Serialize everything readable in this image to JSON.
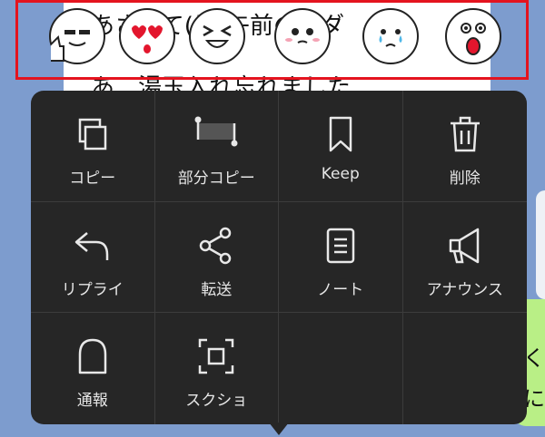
{
  "chat": {
    "line1": "あさって(日)午前の請ダ",
    "line2": "あ　湯玉入れ忘れました",
    "side_line1": "く",
    "side_line2": "に"
  },
  "reactions": [
    {
      "name": "thumbs-up-smile-icon"
    },
    {
      "name": "heart-eyes-icon"
    },
    {
      "name": "laughing-icon"
    },
    {
      "name": "pleading-icon"
    },
    {
      "name": "crying-icon"
    },
    {
      "name": "shocked-icon"
    }
  ],
  "menu": {
    "items": [
      {
        "label": "コピー",
        "icon": "copy-icon"
      },
      {
        "label": "部分コピー",
        "icon": "partial-copy-icon"
      },
      {
        "label": "Keep",
        "icon": "bookmark-icon"
      },
      {
        "label": "削除",
        "icon": "trash-icon"
      },
      {
        "label": "リプライ",
        "icon": "reply-icon"
      },
      {
        "label": "転送",
        "icon": "share-icon"
      },
      {
        "label": "ノート",
        "icon": "note-icon"
      },
      {
        "label": "アナウンス",
        "icon": "megaphone-icon"
      },
      {
        "label": "通報",
        "icon": "report-icon"
      },
      {
        "label": "スクショ",
        "icon": "screenshot-icon"
      }
    ]
  },
  "colors": {
    "background": "#7d9cce",
    "menu": "#262626",
    "highlight_border": "#e4141f",
    "my_bubble": "#b9ef86"
  }
}
